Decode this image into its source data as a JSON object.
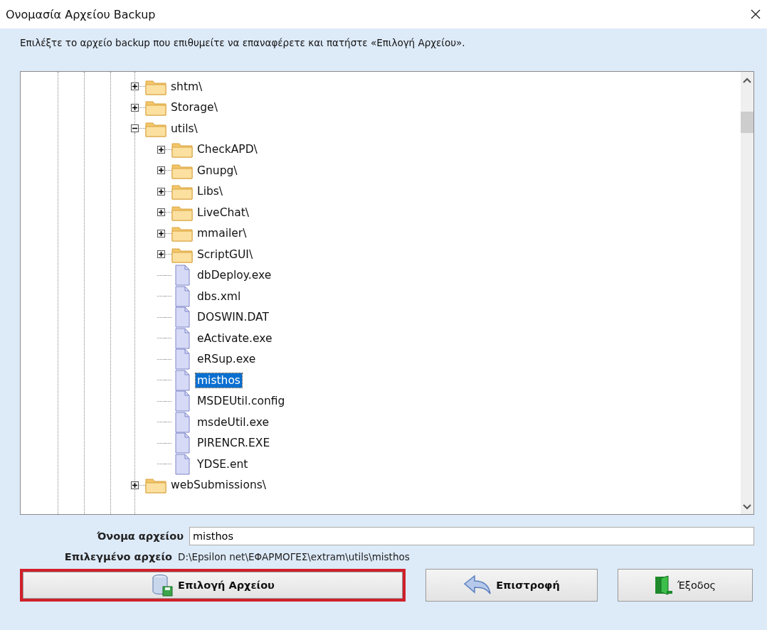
{
  "window": {
    "title": "Ονομασία Αρχείου Backup"
  },
  "instruction": "Επιλέξτε το αρχείο backup που επιθυμείτε να επαναφέρετε και πατήστε «Επιλογή Αρχείου».",
  "tree": [
    {
      "kind": "folder",
      "label": "shtm\\",
      "expanded": false,
      "selected": false
    },
    {
      "kind": "folder",
      "label": "Storage\\",
      "expanded": false,
      "selected": false
    },
    {
      "kind": "folder",
      "label": "utils\\",
      "expanded": true,
      "selected": false,
      "children": [
        {
          "kind": "folder",
          "label": "CheckAPD\\",
          "expanded": false,
          "selected": false
        },
        {
          "kind": "folder",
          "label": "Gnupg\\",
          "expanded": false,
          "selected": false
        },
        {
          "kind": "folder",
          "label": "Libs\\",
          "expanded": false,
          "selected": false
        },
        {
          "kind": "folder",
          "label": "LiveChat\\",
          "expanded": false,
          "selected": false
        },
        {
          "kind": "folder",
          "label": "mmailer\\",
          "expanded": false,
          "selected": false
        },
        {
          "kind": "folder",
          "label": "ScriptGUI\\",
          "expanded": false,
          "selected": false
        },
        {
          "kind": "file",
          "label": "dbDeploy.exe",
          "selected": false
        },
        {
          "kind": "file",
          "label": "dbs.xml",
          "selected": false
        },
        {
          "kind": "file",
          "label": "DOSWIN.DAT",
          "selected": false
        },
        {
          "kind": "file",
          "label": "eActivate.exe",
          "selected": false
        },
        {
          "kind": "file",
          "label": "eRSup.exe",
          "selected": false
        },
        {
          "kind": "file",
          "label": "misthos",
          "selected": true
        },
        {
          "kind": "file",
          "label": "MSDEUtil.config",
          "selected": false
        },
        {
          "kind": "file",
          "label": "msdeUtil.exe",
          "selected": false
        },
        {
          "kind": "file",
          "label": "PIRENCR.EXE",
          "selected": false
        },
        {
          "kind": "file",
          "label": "YDSE.ent",
          "selected": false
        }
      ]
    },
    {
      "kind": "folder",
      "label": "webSubmissions\\",
      "expanded": false,
      "selected": false
    }
  ],
  "filename": {
    "label": "Όνομα αρχείου",
    "value": "misthos"
  },
  "selected_file": {
    "label": "Επιλεγμένο αρχείο",
    "value": "D:\\Epsilon net\\ΕΦΑΡΜΟΓΕΣ\\extram\\utils\\misthos"
  },
  "buttons": [
    {
      "kind": "select",
      "label": "Επιλογή Αρχείου",
      "highlighted": true
    },
    {
      "kind": "back",
      "label": "Επιστροφή",
      "highlighted": false
    },
    {
      "kind": "exit",
      "label": "Έξοδος",
      "highlighted": false
    }
  ]
}
